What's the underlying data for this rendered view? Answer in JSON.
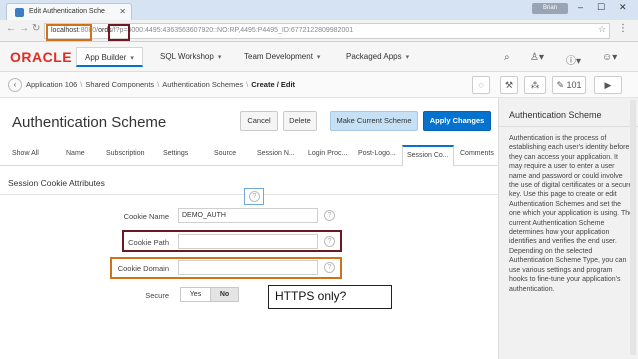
{
  "browser": {
    "tab_title": "Edit Authentication Sche",
    "user_chip": "Brian",
    "url_host": "localhost",
    "url_port": ":8080/",
    "url_path": "ords",
    "url_rest": "/f?p=4000:4495:4363563607920::NO:RP,4495:P4495_ID:6772122809982001"
  },
  "header": {
    "logo": "ORACLE",
    "tabs": [
      "App Builder",
      "SQL Workshop",
      "Team Development",
      "Packaged Apps"
    ]
  },
  "breadcrumb": {
    "items": [
      "Application 106",
      "Shared Components",
      "Authentication Schemes"
    ],
    "current": "Create / Edit",
    "app_count": "101"
  },
  "page": {
    "title": "Authentication Scheme",
    "buttons": {
      "cancel": "Cancel",
      "delete": "Delete",
      "make_current": "Make Current Scheme",
      "apply": "Apply Changes"
    },
    "subtabs": [
      "Show All",
      "Name",
      "Subscription",
      "Settings",
      "Source",
      "Session N...",
      "Login Proc...",
      "Post-Logo...",
      "Session Co...",
      "Comments"
    ],
    "region_title": "Session Cookie Attributes",
    "fields": {
      "cookie_name_label": "Cookie Name",
      "cookie_name_value": "DEMO_AUTH",
      "cookie_path_label": "Cookie Path",
      "cookie_path_value": "",
      "cookie_domain_label": "Cookie Domain",
      "cookie_domain_value": "",
      "secure_label": "Secure",
      "secure_yes": "Yes",
      "secure_no": "No"
    },
    "callout": "HTTPS only?"
  },
  "help": {
    "title": "Authentication Scheme",
    "text": "Authentication is the process of establishing each user's identity before they can access your application. It may require a user to enter a user name and password or could involve the use of digital certificates or a secure key. Use this page to create or edit Authentication Schemes and set the one which your application is using. The current Authentication Scheme determines how your application identifies and verifies the end user. Depending on the selected Authentication Scheme Type, you can use various settings and program hooks to fine-tune your application's authentication."
  },
  "colors": {
    "accent": "#0572ce",
    "highlight_orange": "#d0711c",
    "highlight_maroon": "#6b1a24",
    "oracle_red": "#e32b26"
  }
}
